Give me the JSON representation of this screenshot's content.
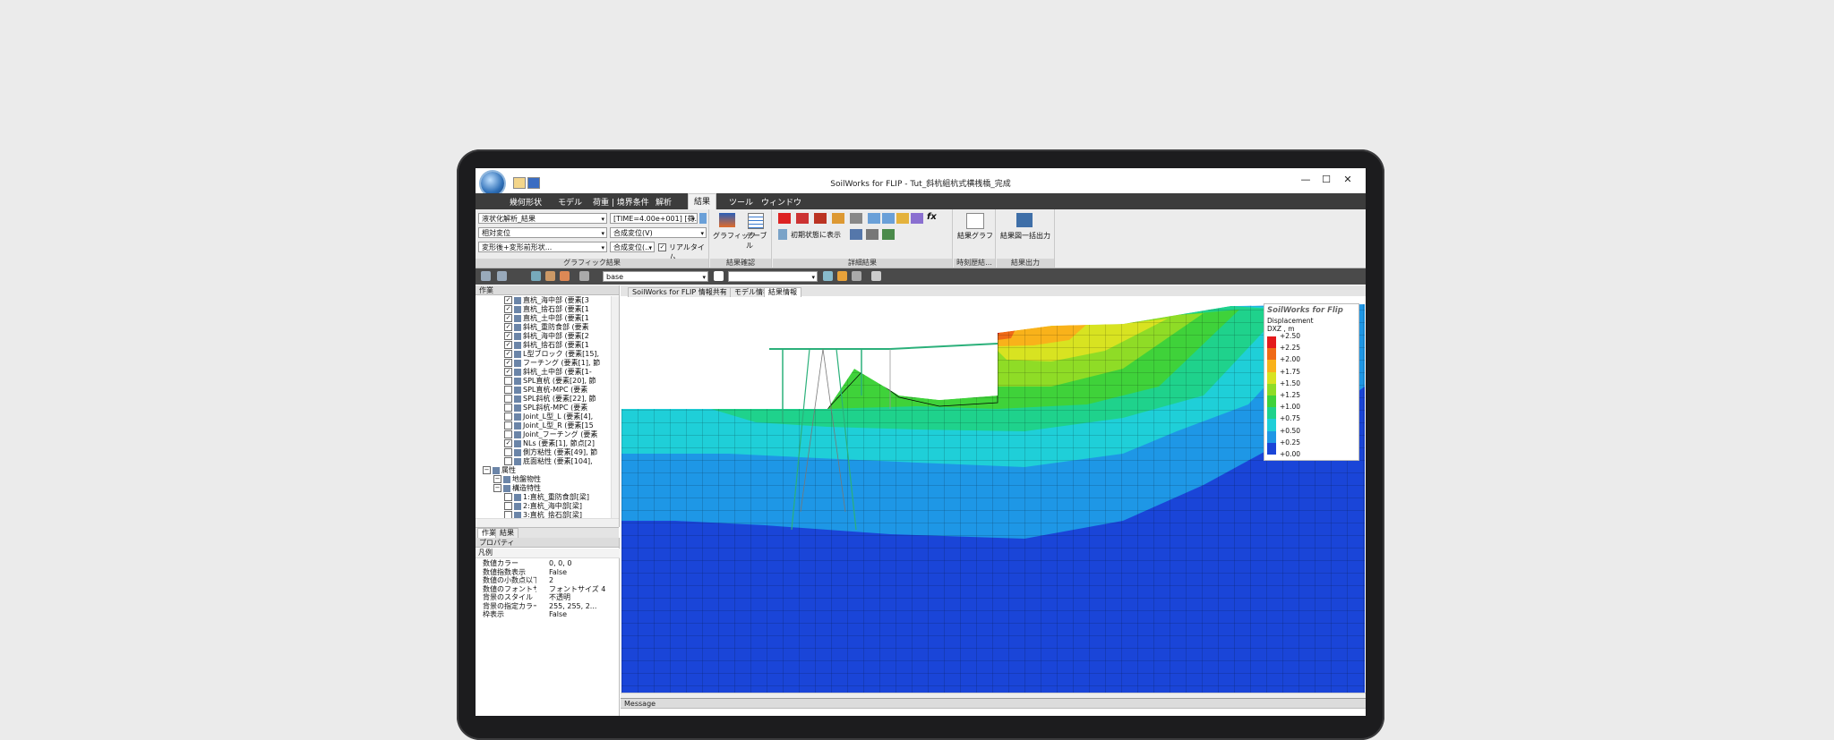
{
  "window": {
    "title": "SoilWorks for FLIP - Tut_斜杭組杭式横桟橋_完成",
    "minimize": "—",
    "maximize": "☐",
    "close": "✕"
  },
  "menu": {
    "items": [
      "幾何形状",
      "モデル",
      "荷重 | 境界条件",
      "解析",
      "結果",
      "ツール",
      "ウィンドウ"
    ]
  },
  "ribbon": {
    "combo1": "液状化解析_結果",
    "combo2": "相対変位",
    "combo3": "変形後+変形前形状...",
    "combo4": "[TIME=4.00e+001] [荷...",
    "combo5": "合成変位(V)",
    "combo6": "合成変位(...",
    "realtime_label": "リアルタイム",
    "group1_label": "グラフィック結果",
    "graphic_btn": "グラフィック",
    "table_btn": "テーブル",
    "group2_label": "結果確認",
    "initial_state_btn": "初期状態に表示",
    "group3_label": "詳細結果",
    "result_graph_btn": "結果グラフ",
    "group4_label": "時刻歴結...",
    "bulk_output_btn": "結果図一括出力",
    "group5_label": "結果出力"
  },
  "toolbar": {
    "view_combo": "base"
  },
  "work_panel": {
    "title": "作業",
    "items": [
      {
        "label": "直杭_海中部 (要素[3",
        "checked": true,
        "level": 2
      },
      {
        "label": "直杭_捨石部 (要素[1",
        "checked": true,
        "level": 2
      },
      {
        "label": "直杭_土中部 (要素[1",
        "checked": true,
        "level": 2
      },
      {
        "label": "斜杭_重防食部 (要素",
        "checked": true,
        "level": 2
      },
      {
        "label": "斜杭_海中部 (要素[2",
        "checked": true,
        "level": 2
      },
      {
        "label": "斜杭_捨石部 (要素[1",
        "checked": true,
        "level": 2
      },
      {
        "label": "L型ブロック (要素[15],",
        "checked": true,
        "level": 2
      },
      {
        "label": "フーチング (要素[1], 節",
        "checked": true,
        "level": 2
      },
      {
        "label": "斜杭_土中部 (要素[1-",
        "checked": true,
        "level": 2
      },
      {
        "label": "SPL直杭 (要素[20], 節",
        "checked": false,
        "level": 2
      },
      {
        "label": "SPL直杭-MPC (要素",
        "checked": false,
        "level": 2
      },
      {
        "label": "SPL斜杭 (要素[22], 節",
        "checked": false,
        "level": 2
      },
      {
        "label": "SPL斜杭-MPC (要素",
        "checked": false,
        "level": 2
      },
      {
        "label": "Joint_L型_L (要素[4],",
        "checked": false,
        "level": 2
      },
      {
        "label": "Joint_L型_R (要素[15",
        "checked": false,
        "level": 2
      },
      {
        "label": "Joint_フーチング (要素",
        "checked": false,
        "level": 2
      },
      {
        "label": "NLs (要素[1], 節点[2]",
        "checked": true,
        "level": 2
      },
      {
        "label": "側方粘性 (要素[49], 節",
        "checked": false,
        "level": 2
      },
      {
        "label": "底面粘性 (要素[104],",
        "checked": false,
        "level": 2
      },
      {
        "label": "属性",
        "checked": null,
        "level": 0
      },
      {
        "label": "地盤物性",
        "checked": null,
        "level": 1
      },
      {
        "label": "構造特性",
        "checked": null,
        "level": 1
      },
      {
        "label": "1:直杭_重防食部[梁]",
        "checked": false,
        "level": 2
      },
      {
        "label": "2:直杭_海中部[梁]",
        "checked": false,
        "level": 2
      },
      {
        "label": "3:直杭_捨石部[梁]",
        "checked": false,
        "level": 2
      }
    ],
    "bottom_tabs": [
      "作業",
      "結果"
    ]
  },
  "properties_panel": {
    "title": "プロパティ",
    "category": "凡例",
    "rows": [
      {
        "name": "数値カラー",
        "value": "0, 0, 0"
      },
      {
        "name": "数値指数表示",
        "value": "False"
      },
      {
        "name": "数値の小数点以下",
        "value": "2"
      },
      {
        "name": "数値のフォントサイズ",
        "value": "フォントサイズ 4"
      },
      {
        "name": "背景のスタイル",
        "value": "不透明"
      },
      {
        "name": "背景の指定カラー",
        "value": "255, 255, 2..."
      },
      {
        "name": "枠表示",
        "value": "False"
      }
    ]
  },
  "doc_tabs": [
    "SoilWorks for FLIP 情報共有",
    "モデル情報",
    "結果情報"
  ],
  "legend": {
    "brand": "SoilWorks for Flip",
    "title": "Displacement",
    "component": "DXZ , m",
    "values": [
      "+2.50",
      "+2.25",
      "+2.00",
      "+1.75",
      "+1.50",
      "+1.25",
      "+1.00",
      "+0.75",
      "+0.50",
      "+0.25",
      "+0.00"
    ],
    "colors": [
      "#e41a1c",
      "#f06a16",
      "#f9b21a",
      "#d8e321",
      "#8fdc26",
      "#3fd23a",
      "#1fd28c",
      "#1fcfd8",
      "#1e97e6",
      "#1a45d8"
    ]
  },
  "message_panel": {
    "title": "Message"
  }
}
